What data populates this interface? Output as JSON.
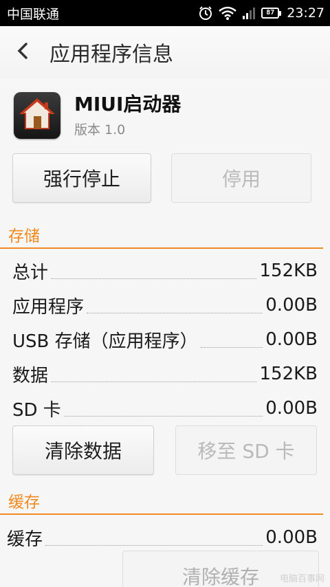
{
  "status_bar": {
    "carrier": "中国联通",
    "battery": "87",
    "time": "23:27"
  },
  "header": {
    "title": "应用程序信息"
  },
  "app": {
    "name": "MIUI启动器",
    "version": "版本 1.0"
  },
  "actions": {
    "force_stop": "强行停止",
    "disable": "停用"
  },
  "storage": {
    "section_title": "存储",
    "rows": [
      {
        "label": "总计",
        "value": "152KB"
      },
      {
        "label": "应用程序",
        "value": "0.00B"
      },
      {
        "label": "USB 存储（应用程序）",
        "value": "0.00B"
      },
      {
        "label": "数据",
        "value": "152KB"
      },
      {
        "label": "SD 卡",
        "value": "0.00B"
      }
    ],
    "clear_data": "清除数据",
    "move_to_sd": "移至 SD 卡"
  },
  "cache": {
    "section_title": "缓存",
    "label": "缓存",
    "value": "0.00B",
    "clear_cache": "清除缓存"
  },
  "watermark": "电脑百事网",
  "colors": {
    "accent": "#f08a1e",
    "status_bg": "#000000"
  }
}
